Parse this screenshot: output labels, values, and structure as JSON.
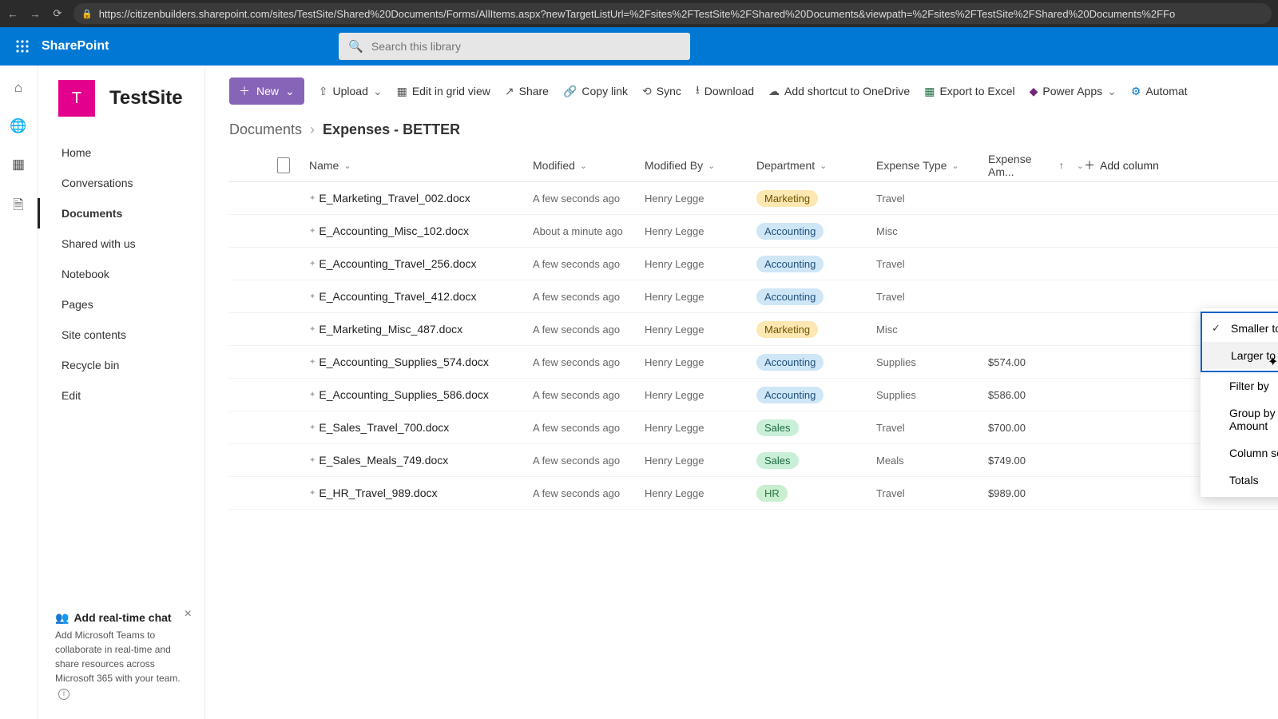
{
  "chrome": {
    "url": "https://citizenbuilders.sharepoint.com/sites/TestSite/Shared%20Documents/Forms/AllItems.aspx?newTargetListUrl=%2Fsites%2FTestSite%2FShared%20Documents&viewpath=%2Fsites%2FTestSite%2FShared%20Documents%2FFo"
  },
  "suite": {
    "app": "SharePoint",
    "search_placeholder": "Search this library"
  },
  "site": {
    "tile_letter": "T",
    "name": "TestSite"
  },
  "nav": {
    "items": [
      "Home",
      "Conversations",
      "Documents",
      "Shared with us",
      "Notebook",
      "Pages",
      "Site contents",
      "Recycle bin",
      "Edit"
    ],
    "active_index": 2
  },
  "cmd": {
    "new": "New",
    "upload": "Upload",
    "edit_grid": "Edit in grid view",
    "share": "Share",
    "copy_link": "Copy link",
    "sync": "Sync",
    "download": "Download",
    "shortcut": "Add shortcut to OneDrive",
    "export": "Export to Excel",
    "powerapps": "Power Apps",
    "automate": "Automat"
  },
  "breadcrumb": {
    "a": "Documents",
    "b": "Expenses - BETTER"
  },
  "columns": {
    "name": "Name",
    "modified": "Modified",
    "modified_by": "Modified By",
    "department": "Department",
    "expense_type": "Expense Type",
    "expense_amount": "Expense Am...",
    "add": "Add column"
  },
  "rows": [
    {
      "name": "E_Marketing_Travel_002.docx",
      "modified": "A few seconds ago",
      "by": "Henry Legge",
      "dept": "Marketing",
      "type": "Travel",
      "amt": ""
    },
    {
      "name": "E_Accounting_Misc_102.docx",
      "modified": "About a minute ago",
      "by": "Henry Legge",
      "dept": "Accounting",
      "type": "Misc",
      "amt": ""
    },
    {
      "name": "E_Accounting_Travel_256.docx",
      "modified": "A few seconds ago",
      "by": "Henry Legge",
      "dept": "Accounting",
      "type": "Travel",
      "amt": ""
    },
    {
      "name": "E_Accounting_Travel_412.docx",
      "modified": "A few seconds ago",
      "by": "Henry Legge",
      "dept": "Accounting",
      "type": "Travel",
      "amt": ""
    },
    {
      "name": "E_Marketing_Misc_487.docx",
      "modified": "A few seconds ago",
      "by": "Henry Legge",
      "dept": "Marketing",
      "type": "Misc",
      "amt": ""
    },
    {
      "name": "E_Accounting_Supplies_574.docx",
      "modified": "A few seconds ago",
      "by": "Henry Legge",
      "dept": "Accounting",
      "type": "Supplies",
      "amt": "$574.00"
    },
    {
      "name": "E_Accounting_Supplies_586.docx",
      "modified": "A few seconds ago",
      "by": "Henry Legge",
      "dept": "Accounting",
      "type": "Supplies",
      "amt": "$586.00"
    },
    {
      "name": "E_Sales_Travel_700.docx",
      "modified": "A few seconds ago",
      "by": "Henry Legge",
      "dept": "Sales",
      "type": "Travel",
      "amt": "$700.00"
    },
    {
      "name": "E_Sales_Meals_749.docx",
      "modified": "A few seconds ago",
      "by": "Henry Legge",
      "dept": "Sales",
      "type": "Meals",
      "amt": "$749.00"
    },
    {
      "name": "E_HR_Travel_989.docx",
      "modified": "A few seconds ago",
      "by": "Henry Legge",
      "dept": "HR",
      "type": "Travel",
      "amt": "$989.00"
    }
  ],
  "dropdown": {
    "smaller": "Smaller to larger",
    "larger": "Larger to smaller",
    "filter": "Filter by",
    "group": "Group by Expense Amount",
    "settings": "Column settings",
    "totals": "Totals"
  },
  "chat": {
    "title": "Add real-time chat",
    "body": "Add Microsoft Teams to collaborate in real-time and share resources across Microsoft 365 with your team."
  }
}
